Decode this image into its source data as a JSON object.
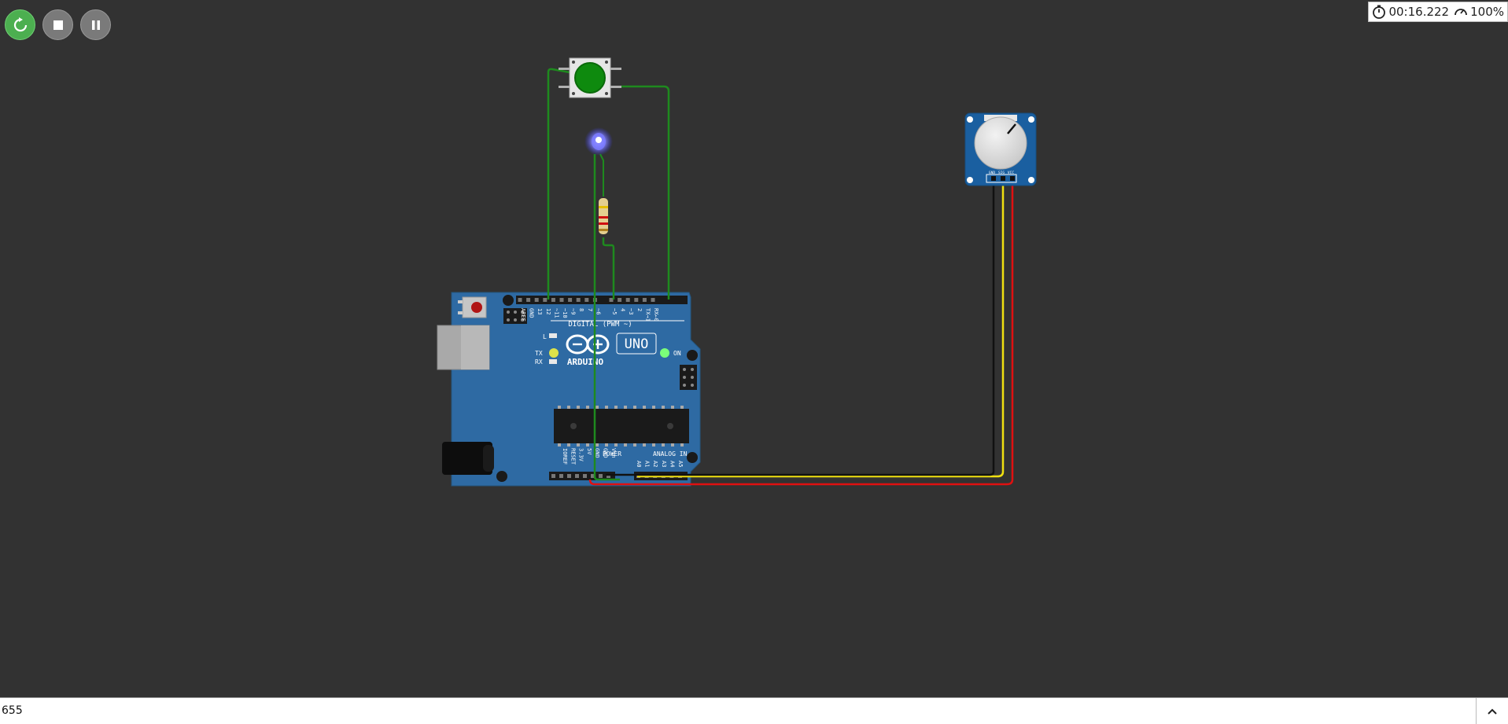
{
  "toolbar": {
    "restart_icon": "restart-icon",
    "stop_icon": "stop-icon",
    "pause_icon": "pause-icon"
  },
  "status": {
    "timer": "00:16.222",
    "speed": "100%"
  },
  "arduino": {
    "board_name": "UNO",
    "brand": "ARDUINO",
    "digital_label": "DIGITAL (PWM ~)",
    "on_label": "ON",
    "tx_label": "TX",
    "rx_label": "RX",
    "l_label": "L",
    "power_label": "POWER",
    "analog_label": "ANALOG IN",
    "top_pins": [
      "AREF",
      "GND",
      "13",
      "12",
      "~11",
      "~10",
      "~9",
      "8",
      "7",
      "~6",
      "~5",
      "4",
      "~3",
      "2",
      "TX→1",
      "RX←0"
    ],
    "power_pins": [
      "IOREF",
      "RESET",
      "3.3V",
      "5V",
      "GND",
      "GND",
      "Vin"
    ],
    "analog_pins": [
      "A0",
      "A1",
      "A2",
      "A3",
      "A4",
      "A5"
    ]
  },
  "potentiometer": {
    "pins": [
      "GND",
      "SIG",
      "VCC"
    ]
  },
  "serial_monitor": {
    "output": "655"
  },
  "colors": {
    "background": "#323232",
    "board": "#2e6aa3",
    "wire_green": "#1e8a1e",
    "wire_red": "#e01010",
    "wire_yellow": "#f0e010",
    "wire_black": "#111111",
    "led_blue": "#6a6aff",
    "button_cap": "#0e8a0e"
  }
}
